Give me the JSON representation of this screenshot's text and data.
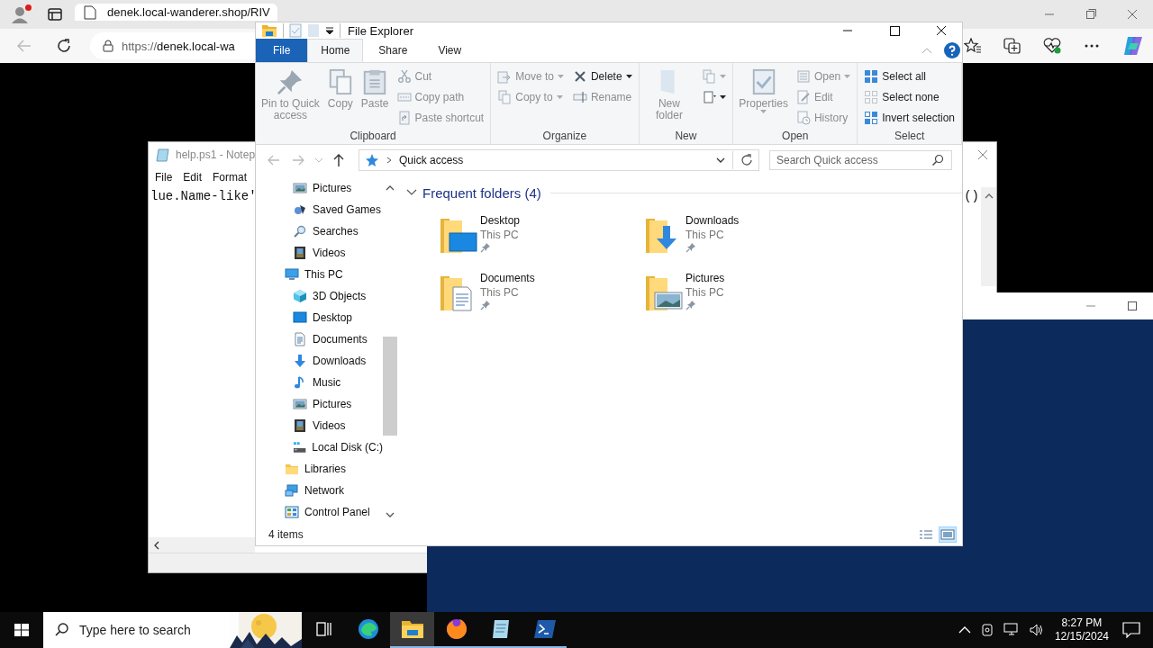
{
  "browser": {
    "profile_notification": true,
    "tab": {
      "title": "denek.local-wanderer.shop/RIV"
    },
    "address": {
      "scheme": "https://",
      "host": "denek.local-wa"
    }
  },
  "notepad": {
    "title": "help.ps1 - Notep",
    "menu": [
      "File",
      "Edit",
      "Format"
    ],
    "line": "lue.Name-like'",
    "right_fragment": "()"
  },
  "explorer": {
    "title": "File Explorer",
    "tabs": [
      {
        "label": "File",
        "kind": "file",
        "selected": false
      },
      {
        "label": "Home",
        "kind": "tab",
        "selected": true
      },
      {
        "label": "Share",
        "kind": "tab",
        "selected": false
      },
      {
        "label": "View",
        "kind": "tab",
        "selected": false
      }
    ],
    "ribbon": [
      {
        "label": "Clipboard",
        "columns": [
          {
            "kind": "large",
            "buttons": [
              {
                "label": "Pin to Quick access",
                "disabled": true
              }
            ]
          },
          {
            "kind": "large",
            "buttons": [
              {
                "label": "Copy",
                "disabled": true
              }
            ]
          },
          {
            "kind": "large",
            "buttons": [
              {
                "label": "Paste",
                "disabled": true
              }
            ]
          },
          {
            "kind": "stack",
            "buttons": [
              {
                "label": "Cut",
                "disabled": true
              },
              {
                "label": "Copy path",
                "disabled": true
              },
              {
                "label": "Paste shortcut",
                "disabled": true
              }
            ]
          }
        ]
      },
      {
        "label": "Organize",
        "columns": [
          {
            "kind": "stack",
            "buttons": [
              {
                "label": "Move to",
                "disabled": true,
                "dropdown": true
              },
              {
                "label": "Copy to",
                "disabled": true,
                "dropdown": true
              }
            ]
          },
          {
            "kind": "stack",
            "buttons": [
              {
                "label": "Delete",
                "disabled": false,
                "dropdown": true
              },
              {
                "label": "Rename",
                "disabled": true
              }
            ]
          }
        ]
      },
      {
        "label": "New",
        "columns": [
          {
            "kind": "large",
            "buttons": [
              {
                "label": "New folder",
                "disabled": true
              }
            ]
          },
          {
            "kind": "stack",
            "buttons": [
              {
                "disabled": true,
                "dropdown": true
              },
              {
                "disabled": false,
                "dropdown": true
              }
            ]
          }
        ]
      },
      {
        "label": "Open",
        "columns": [
          {
            "kind": "large",
            "buttons": [
              {
                "label": "Properties",
                "disabled": true,
                "dropdown": true
              }
            ]
          },
          {
            "kind": "stack",
            "buttons": [
              {
                "label": "Open",
                "disabled": true,
                "dropdown": true
              },
              {
                "label": "Edit",
                "disabled": true
              },
              {
                "label": "History",
                "disabled": true
              }
            ]
          }
        ]
      },
      {
        "label": "Select",
        "columns": [
          {
            "kind": "stack",
            "buttons": [
              {
                "label": "Select all",
                "disabled": false
              },
              {
                "label": "Select none",
                "disabled": false
              },
              {
                "label": "Invert selection",
                "disabled": false
              }
            ]
          }
        ]
      }
    ],
    "address": {
      "location": "Quick access"
    },
    "search": {
      "placeholder": "Search Quick access"
    },
    "nav_pane": {
      "partial_children": [
        {
          "label": "Pictures"
        },
        {
          "label": "Saved Games"
        },
        {
          "label": "Searches"
        },
        {
          "label": "Videos"
        }
      ],
      "items": [
        {
          "label": "This PC",
          "children": [
            {
              "label": "3D Objects"
            },
            {
              "label": "Desktop"
            },
            {
              "label": "Documents"
            },
            {
              "label": "Downloads"
            },
            {
              "label": "Music"
            },
            {
              "label": "Pictures"
            },
            {
              "label": "Videos"
            },
            {
              "label": "Local Disk (C:)"
            }
          ]
        },
        {
          "label": "Libraries"
        },
        {
          "label": "Network"
        },
        {
          "label": "Control Panel"
        }
      ]
    },
    "section": {
      "title": "Frequent folders (4)",
      "expanded": true,
      "tiles": [
        {
          "name": "Desktop",
          "location": "This PC",
          "pinned": true
        },
        {
          "name": "Downloads",
          "location": "This PC",
          "pinned": true
        },
        {
          "name": "Documents",
          "location": "This PC",
          "pinned": true
        },
        {
          "name": "Pictures",
          "location": "This PC",
          "pinned": true
        }
      ]
    },
    "status": {
      "count": "4 items",
      "views": [
        {
          "selected": false
        },
        {
          "selected": true
        }
      ]
    }
  },
  "taskbar": {
    "search": {
      "placeholder": "Type here to search"
    },
    "apps": [
      {
        "selected": false,
        "running": false
      },
      {
        "selected": false,
        "running": false
      },
      {
        "selected": true,
        "running": true
      },
      {
        "selected": false,
        "running": true
      },
      {
        "selected": false,
        "running": true
      },
      {
        "selected": false,
        "running": true
      }
    ],
    "clock": {
      "time": "8:27 PM",
      "date": "12/15/2024"
    }
  }
}
